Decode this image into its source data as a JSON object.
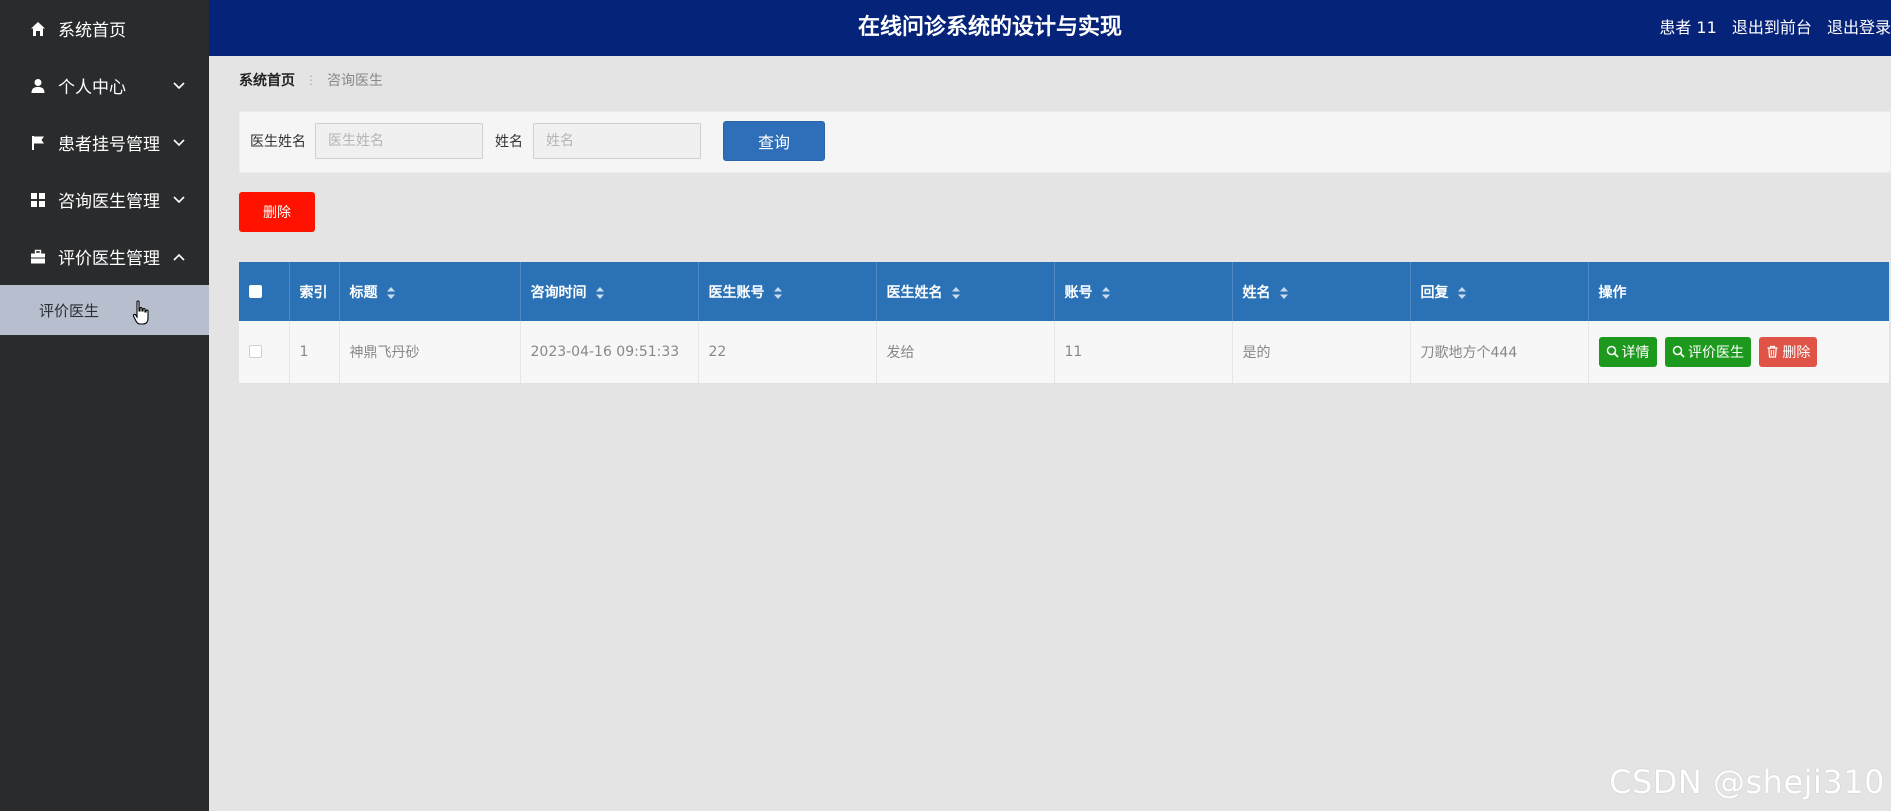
{
  "sidebar": {
    "items": [
      {
        "label": "系统首页",
        "icon": "home-icon"
      },
      {
        "label": "个人中心",
        "icon": "user-icon"
      },
      {
        "label": "患者挂号管理",
        "icon": "flag-icon"
      },
      {
        "label": "咨询医生管理",
        "icon": "grid-icon"
      },
      {
        "label": "评价医生管理",
        "icon": "briefcase-icon"
      }
    ],
    "sub_items": [
      {
        "label": "评价医生"
      }
    ]
  },
  "header": {
    "title": "在线问诊系统的设计与实现",
    "user": "患者 11",
    "front_link": "退出到前台",
    "logout_link": "退出登录"
  },
  "breadcrumb": {
    "home": "系统首页",
    "current": "咨询医生"
  },
  "search": {
    "doctor_name_label": "医生姓名",
    "doctor_name_placeholder": "医生姓名",
    "name_label": "姓名",
    "name_placeholder": "姓名",
    "query_button": "查询"
  },
  "toolbar": {
    "delete_button": "删除"
  },
  "table": {
    "columns": [
      "索引",
      "标题",
      "咨询时间",
      "医生账号",
      "医生姓名",
      "账号",
      "姓名",
      "回复",
      "操作"
    ],
    "rows": [
      {
        "index": "1",
        "title": "神鼎飞丹砂",
        "consult_time": "2023-04-16 09:51:33",
        "doctor_account": "22",
        "doctor_name": "发给",
        "account": "11",
        "name": "是的",
        "reply": "刀歌地方个444",
        "actions": {
          "detail": "详情",
          "evaluate": "评价医生",
          "delete": "删除"
        }
      }
    ]
  },
  "watermark": "CSDN @sheji310",
  "colors": {
    "sidebar_bg": "#2a2b2c",
    "header_bg": "#06237a",
    "table_header_bg": "#2a72b5",
    "query_button": "#2f6fb9",
    "delete_button": "#ff1200",
    "action_green": "#1d9a1d",
    "action_red": "#df5447"
  }
}
